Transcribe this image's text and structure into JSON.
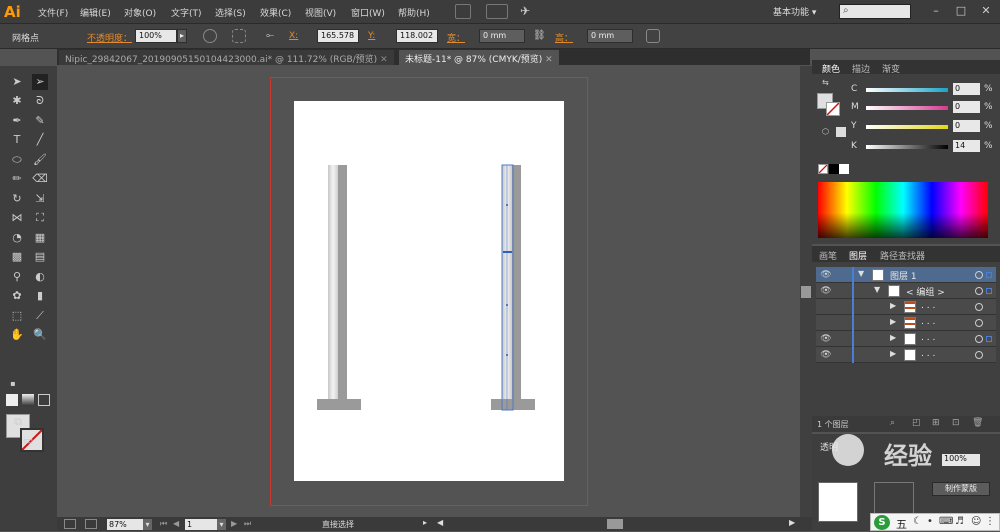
{
  "app": {
    "logo": "Ai"
  },
  "menu": [
    "文件(F)",
    "编辑(E)",
    "对象(O)",
    "文字(T)",
    "选择(S)",
    "效果(C)",
    "视图(V)",
    "窗口(W)",
    "帮助(H)"
  ],
  "workspace": "基本功能",
  "control": {
    "mode_label": "网格点",
    "opacity_label": "不透明度：",
    "opacity_value": "100%",
    "x_label": "X:",
    "x_value": "165.578",
    "y_label": "Y:",
    "y_value": "118.002",
    "w_label": "宽：",
    "w_value": "0 mm",
    "h_label": "高：",
    "h_value": "0 mm"
  },
  "tabs": [
    {
      "label": "Nipic_29842067_20190905150104423000.ai* @ 111.72% (RGB/预览)"
    },
    {
      "label": "未标题-11* @ 87% (CMYK/预览)"
    }
  ],
  "status": {
    "zoom": "87%",
    "page": "1",
    "tool": "直接选择"
  },
  "color_panel": {
    "tabs": [
      "颜色",
      "描边",
      "渐变"
    ],
    "channels": [
      {
        "label": "C",
        "value": "0",
        "color": "#1aa3c9"
      },
      {
        "label": "M",
        "value": "0",
        "color": "#d43a8f"
      },
      {
        "label": "Y",
        "value": "0",
        "color": "#e3d51a"
      },
      {
        "label": "K",
        "value": "14",
        "color": "#777777"
      }
    ],
    "pct": "%"
  },
  "layers_panel": {
    "tabs": [
      "画笔",
      "图层",
      "路径查找器"
    ],
    "rows": [
      {
        "name": "图层 1",
        "selected": true
      },
      {
        "name": "< 编组 >",
        "selected": false
      },
      {
        "name": ". . .",
        "selected": false
      },
      {
        "name": ". . .",
        "selected": false
      },
      {
        "name": ". . .",
        "selected": false
      },
      {
        "name": ". . .",
        "selected": false
      }
    ],
    "footer": "1 个图层"
  },
  "transparency": {
    "title": "透明",
    "opacity": "100%",
    "make_mask": "制作蒙版"
  },
  "watermark": {
    "brand": "经验"
  },
  "ime": {
    "label": "五"
  }
}
